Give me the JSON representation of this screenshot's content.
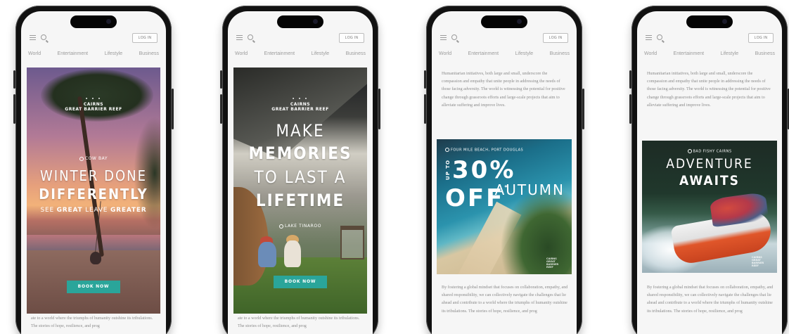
{
  "header": {
    "login_label": "LOG IN"
  },
  "nav": [
    "World",
    "Entertainment",
    "Lifestyle",
    "Business"
  ],
  "ads": {
    "ad1": {
      "brand_top": "CAIRNS",
      "brand_bottom": "GREAT BARRIER REEF",
      "location": "COW BAY",
      "headline_line1": "WINTER DONE",
      "headline_line2": "DIFFERENTLY",
      "tagline_prefix": "SEE",
      "tagline_bold1": "GREAT",
      "tagline_mid": "LEAVE",
      "tagline_bold2": "GREATER",
      "cta": "BOOK NOW"
    },
    "ad2": {
      "brand_top": "CAIRNS",
      "brand_bottom": "GREAT BARRIER REEF",
      "headline_line1": "MAKE",
      "headline_line2": "MEMORIES",
      "headline_line3": "TO LAST A",
      "headline_line4": "LIFETIME",
      "location": "LAKE TINAROO",
      "cta": "BOOK NOW"
    },
    "ad3": {
      "location": "FOUR MILE BEACH, PORT DOUGLAS",
      "prefix": "UP TO",
      "deal": "30% OFF",
      "asterisk": "*",
      "season": "AUTUMN",
      "logo": "CAIRNS GREAT BARRIER REEF"
    },
    "ad4": {
      "location": "BAD FISHY CAIRNS",
      "headline_line1": "ADVENTURE",
      "headline_line2": "AWAITS",
      "logo": "CAIRNS GREAT BARRIER REEF"
    }
  },
  "article": {
    "phone1_bottom": "ate to a world where the triumphs of humanity outshine its tribulations. The stories of hope, resilience, and prog",
    "phone2_bottom": "ate to a world where the triumphs of humanity outshine its tribulations. The stories of hope, resilience, and prog",
    "top_paragraph": "Humanitarian initiatives, both large and small, underscore the compassion and empathy that unite people in addressing the needs of those facing adversity. The world is witnessing the potential for positive change through grassroots efforts and large-scale projects that aim to alleviate suffering and improve lives.",
    "bottom_paragraph": "By fostering a global mindset that focuses on collaboration, empathy, and shared responsibility, we can collectively navigate the challenges that lie ahead and contribute to a world where the triumphs of humanity outshine its tribulations. The stories of hope, resilience, and prog"
  }
}
